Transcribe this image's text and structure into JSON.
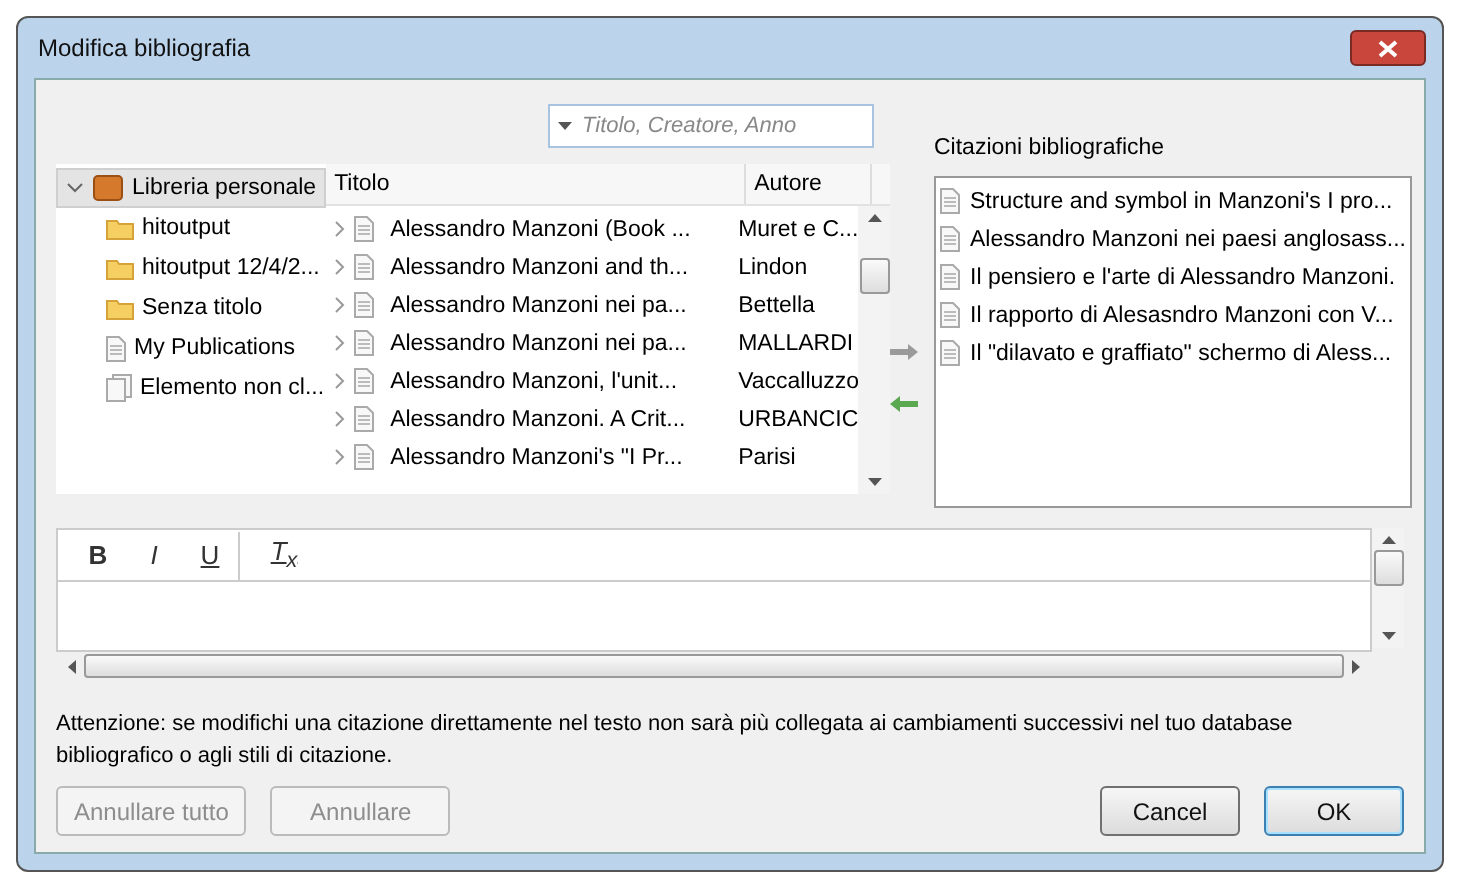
{
  "window": {
    "title": "Modifica bibliografia"
  },
  "search": {
    "placeholder": "Titolo, Creatore, Anno"
  },
  "tree": {
    "items": [
      {
        "label": "Libreria personale",
        "kind": "library",
        "selected": true,
        "expanded": true,
        "children": [
          {
            "label": "hitoutput",
            "kind": "folder",
            "selected": false
          },
          {
            "label": "hitoutput 12/4/2...",
            "kind": "folder",
            "selected": false
          },
          {
            "label": "Senza titolo",
            "kind": "folder",
            "selected": false
          },
          {
            "label": "My Publications",
            "kind": "document",
            "selected": false
          },
          {
            "label": "Elemento non cl...",
            "kind": "stack",
            "selected": false
          }
        ]
      }
    ]
  },
  "table": {
    "columns": [
      "Titolo",
      "Autore"
    ],
    "rows": [
      {
        "title": "Alessandro Manzoni (Book ...",
        "author": "Muret e C..."
      },
      {
        "title": "Alessandro Manzoni and th...",
        "author": "Lindon"
      },
      {
        "title": "Alessandro Manzoni nei pa...",
        "author": "Bettella"
      },
      {
        "title": "Alessandro Manzoni nei pa...",
        "author": "MALLARDI"
      },
      {
        "title": "Alessandro Manzoni, l'unit...",
        "author": "Vaccalluzzo"
      },
      {
        "title": "Alessandro Manzoni. A Crit...",
        "author": "URBANCIC"
      },
      {
        "title": "Alessandro Manzoni's \"I Pr...",
        "author": "Parisi"
      }
    ]
  },
  "citations": {
    "label": "Citazioni bibliografiche",
    "items": [
      "Structure and symbol in Manzoni's I pro...",
      "Alessandro Manzoni nei paesi anglosass...",
      "Il pensiero e l'arte di Alessandro Manzoni.",
      "Il rapporto di Alesasndro Manzoni con V...",
      "Il \"dilavato e graffiato\" schermo di Aless..."
    ]
  },
  "editor": {
    "tools": [
      {
        "kind": "bold",
        "label": "B"
      },
      {
        "kind": "italic",
        "label": "I"
      },
      {
        "kind": "underline",
        "label": "U"
      },
      {
        "kind": "clear",
        "label": "T$_{x}$"
      }
    ]
  },
  "warning": "Attenzione: se modifichi una citazione direttamente nel testo non sarà più collegata ai cambiamenti successivi nel tuo database bibliografico o agli stili di citazione.",
  "buttons_left": [
    {
      "label": "Annullare tutto",
      "disabled": true
    },
    {
      "label": "Annullare",
      "disabled": true
    }
  ],
  "buttons_right": [
    {
      "label": "Cancel",
      "default": false
    },
    {
      "label": "OK",
      "default": true
    }
  ]
}
